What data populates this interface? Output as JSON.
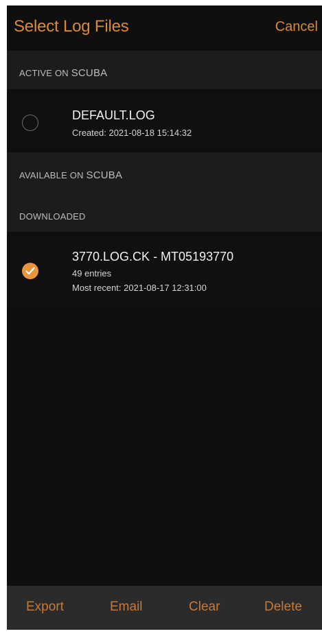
{
  "nav": {
    "title": "Select Log Files",
    "cancel_label": "Cancel"
  },
  "sections": {
    "active": {
      "label_prefix": "ACTIVE ON",
      "label_suffix": "SCUBA"
    },
    "available": {
      "label_prefix": "AVAILABLE ON",
      "label_suffix": "SCUBA"
    },
    "downloaded": {
      "label": "DOWNLOADED"
    }
  },
  "active_log": {
    "name": "DEFAULT.LOG",
    "created": "Created: 2021-08-18 15:14:32",
    "selected": false
  },
  "downloaded_log": {
    "name": "3770.LOG.CK - MT05193770",
    "entries": "49 entries",
    "most_recent": "Most recent: 2021-08-17 12:31:00",
    "selected": true
  },
  "toolbar": {
    "export_label": "Export",
    "email_label": "Email",
    "clear_label": "Clear",
    "delete_label": "Delete"
  },
  "colors": {
    "accent": "#d9893b",
    "background": "#0e0e0e",
    "section_header": "#1c1c1d",
    "toolbar": "#2b2b2c"
  },
  "icons": {
    "radio_off": "radio-unchecked-icon",
    "radio_on": "checkmark-circle-icon"
  }
}
